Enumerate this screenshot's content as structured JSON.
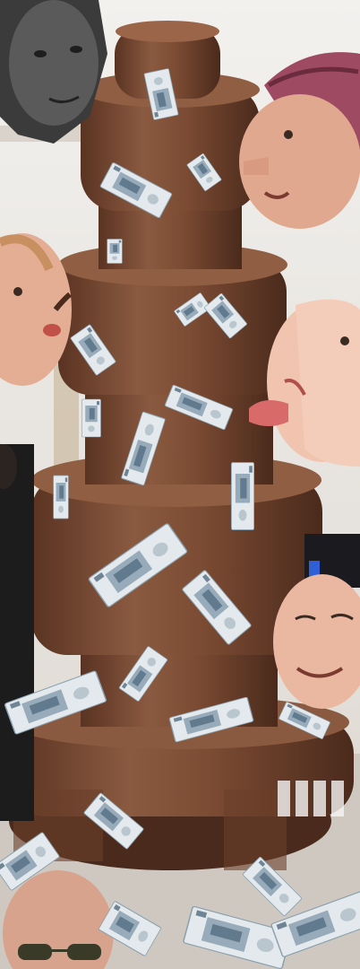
{
  "scene": {
    "kind": "photo-collage",
    "subject": "chocolate-fountain",
    "note_count": 24,
    "face_count": 7,
    "colors": {
      "wall": "#efede9",
      "chocolate": "#7a4a32",
      "chocolate_dark": "#4a2a1c",
      "banknote": "#dfe6ea",
      "banknote_ink": "#3d5a72",
      "skin": "#e7b59b"
    }
  },
  "items": {
    "fountain": "chocolate-fountain",
    "banknotes": "ruble-banknotes",
    "faces": [
      "face-top-left-grayscale",
      "face-top-right-headscarf",
      "face-left-tasting",
      "face-right-tongue-out",
      "face-right-smiling",
      "face-bottom-left-sunglasses",
      "person-left-edge-dark-suit"
    ]
  }
}
